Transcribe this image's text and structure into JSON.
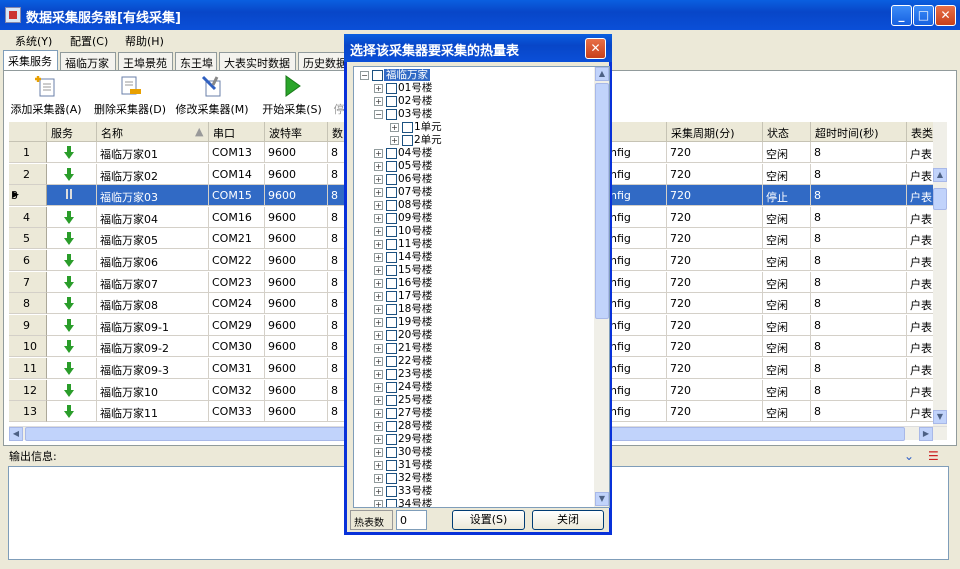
{
  "window": {
    "title": "数据采集服务器[有线采集]"
  },
  "menu": [
    "系统(Y)",
    "配置(C)",
    "帮助(H)"
  ],
  "tabs": [
    "采集服务",
    "福临万家",
    "王埠景苑",
    "东王埠",
    "大表实时数据",
    "历史数据"
  ],
  "toolbar": {
    "add": "添加采集器(A)",
    "delete": "删除采集器(D)",
    "modify": "修改采集器(M)",
    "start": "开始采集(S)",
    "stop_partial": "停"
  },
  "grid": {
    "headers_left": [
      "服务",
      "名称",
      "串口",
      "波特率",
      "数"
    ],
    "headers_right": [
      "采集周期(分)",
      "状态",
      "超时时间(秒)",
      "表类"
    ],
    "rows": [
      {
        "num": "1",
        "icon": "down-arrow",
        "name": "福临万家01",
        "port": "COM13",
        "baud": "9600",
        "d": "8",
        "cfg": "nfig",
        "period": "720",
        "status": "空闲",
        "timeout": "8",
        "type": "户表"
      },
      {
        "num": "2",
        "icon": "down-arrow",
        "name": "福临万家02",
        "port": "COM14",
        "baud": "9600",
        "d": "8",
        "cfg": "nfig",
        "period": "720",
        "status": "空闲",
        "timeout": "8",
        "type": "户表"
      },
      {
        "num": "3",
        "icon": "pause",
        "name": "福临万家03",
        "port": "COM15",
        "baud": "9600",
        "d": "8",
        "cfg": "nfig",
        "period": "720",
        "status": "停止",
        "timeout": "8",
        "type": "户表",
        "selected": true
      },
      {
        "num": "4",
        "icon": "down-arrow",
        "name": "福临万家04",
        "port": "COM16",
        "baud": "9600",
        "d": "8",
        "cfg": "nfig",
        "period": "720",
        "status": "空闲",
        "timeout": "8",
        "type": "户表"
      },
      {
        "num": "5",
        "icon": "down-arrow",
        "name": "福临万家05",
        "port": "COM21",
        "baud": "9600",
        "d": "8",
        "cfg": "nfig",
        "period": "720",
        "status": "空闲",
        "timeout": "8",
        "type": "户表"
      },
      {
        "num": "6",
        "icon": "down-arrow",
        "name": "福临万家06",
        "port": "COM22",
        "baud": "9600",
        "d": "8",
        "cfg": "nfig",
        "period": "720",
        "status": "空闲",
        "timeout": "8",
        "type": "户表"
      },
      {
        "num": "7",
        "icon": "down-arrow",
        "name": "福临万家07",
        "port": "COM23",
        "baud": "9600",
        "d": "8",
        "cfg": "nfig",
        "period": "720",
        "status": "空闲",
        "timeout": "8",
        "type": "户表"
      },
      {
        "num": "8",
        "icon": "down-arrow",
        "name": "福临万家08",
        "port": "COM24",
        "baud": "9600",
        "d": "8",
        "cfg": "nfig",
        "period": "720",
        "status": "空闲",
        "timeout": "8",
        "type": "户表"
      },
      {
        "num": "9",
        "icon": "down-arrow",
        "name": "福临万家09-1",
        "port": "COM29",
        "baud": "9600",
        "d": "8",
        "cfg": "nfig",
        "period": "720",
        "status": "空闲",
        "timeout": "8",
        "type": "户表"
      },
      {
        "num": "10",
        "icon": "down-arrow",
        "name": "福临万家09-2",
        "port": "COM30",
        "baud": "9600",
        "d": "8",
        "cfg": "nfig",
        "period": "720",
        "status": "空闲",
        "timeout": "8",
        "type": "户表"
      },
      {
        "num": "11",
        "icon": "down-arrow",
        "name": "福临万家09-3",
        "port": "COM31",
        "baud": "9600",
        "d": "8",
        "cfg": "nfig",
        "period": "720",
        "status": "空闲",
        "timeout": "8",
        "type": "户表"
      },
      {
        "num": "12",
        "icon": "down-arrow",
        "name": "福临万家10",
        "port": "COM32",
        "baud": "9600",
        "d": "8",
        "cfg": "nfig",
        "period": "720",
        "status": "空闲",
        "timeout": "8",
        "type": "户表"
      },
      {
        "num": "13",
        "icon": "down-arrow",
        "name": "福临万家11",
        "port": "COM33",
        "baud": "9600",
        "d": "8",
        "cfg": "nfig",
        "period": "720",
        "status": "空闲",
        "timeout": "8",
        "type": "户表"
      }
    ]
  },
  "output": {
    "label": "输出信息:"
  },
  "dialog": {
    "title": "选择该采集器要采集的热量表",
    "root": "福临万家",
    "nodes": [
      {
        "label": "01号楼",
        "level": 1,
        "exp": "+"
      },
      {
        "label": "02号楼",
        "level": 1,
        "exp": "+"
      },
      {
        "label": "03号楼",
        "level": 1,
        "exp": "-"
      },
      {
        "label": "1单元",
        "level": 2,
        "exp": "+"
      },
      {
        "label": "2单元",
        "level": 2,
        "exp": "+"
      },
      {
        "label": "04号楼",
        "level": 1,
        "exp": "+"
      },
      {
        "label": "05号楼",
        "level": 1,
        "exp": "+"
      },
      {
        "label": "06号楼",
        "level": 1,
        "exp": "+"
      },
      {
        "label": "07号楼",
        "level": 1,
        "exp": "+"
      },
      {
        "label": "08号楼",
        "level": 1,
        "exp": "+"
      },
      {
        "label": "09号楼",
        "level": 1,
        "exp": "+"
      },
      {
        "label": "10号楼",
        "level": 1,
        "exp": "+"
      },
      {
        "label": "11号楼",
        "level": 1,
        "exp": "+"
      },
      {
        "label": "14号楼",
        "level": 1,
        "exp": "+"
      },
      {
        "label": "15号楼",
        "level": 1,
        "exp": "+"
      },
      {
        "label": "16号楼",
        "level": 1,
        "exp": "+"
      },
      {
        "label": "17号楼",
        "level": 1,
        "exp": "+"
      },
      {
        "label": "18号楼",
        "level": 1,
        "exp": "+"
      },
      {
        "label": "19号楼",
        "level": 1,
        "exp": "+"
      },
      {
        "label": "20号楼",
        "level": 1,
        "exp": "+"
      },
      {
        "label": "21号楼",
        "level": 1,
        "exp": "+"
      },
      {
        "label": "22号楼",
        "level": 1,
        "exp": "+"
      },
      {
        "label": "23号楼",
        "level": 1,
        "exp": "+"
      },
      {
        "label": "24号楼",
        "level": 1,
        "exp": "+"
      },
      {
        "label": "25号楼",
        "level": 1,
        "exp": "+"
      },
      {
        "label": "27号楼",
        "level": 1,
        "exp": "+"
      },
      {
        "label": "28号楼",
        "level": 1,
        "exp": "+"
      },
      {
        "label": "29号楼",
        "level": 1,
        "exp": "+"
      },
      {
        "label": "30号楼",
        "level": 1,
        "exp": "+"
      },
      {
        "label": "31号楼",
        "level": 1,
        "exp": "+"
      },
      {
        "label": "32号楼",
        "level": 1,
        "exp": "+"
      },
      {
        "label": "33号楼",
        "level": 1,
        "exp": "+"
      },
      {
        "label": "34号楼",
        "level": 1,
        "exp": "+"
      }
    ],
    "count_label": "热表数",
    "count_value": "0",
    "set_button": "设置(S)",
    "close_button": "关闭"
  }
}
